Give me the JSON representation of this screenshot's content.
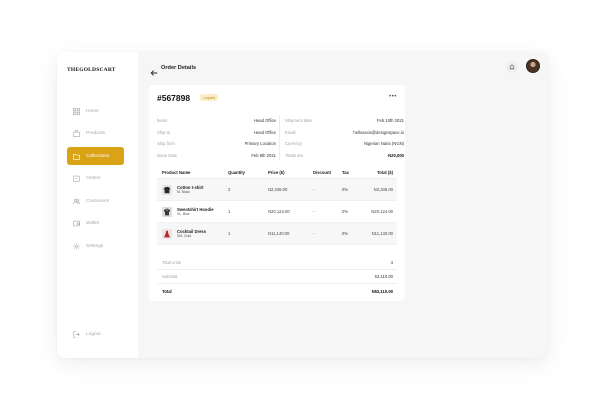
{
  "app": {
    "brand": "THEGOLDSCART",
    "page_title": "Order Details"
  },
  "sidebar": {
    "items": [
      {
        "label": "Home",
        "icon": "grid-icon"
      },
      {
        "label": "Products",
        "icon": "bag-icon"
      },
      {
        "label": "Collections",
        "icon": "folder-icon",
        "active": true
      },
      {
        "label": "Orders",
        "icon": "box-icon"
      },
      {
        "label": "Customers",
        "icon": "users-icon"
      },
      {
        "label": "Wallet",
        "icon": "wallet-icon"
      },
      {
        "label": "Settings",
        "icon": "gear-icon"
      }
    ],
    "logout_label": "Logout"
  },
  "order": {
    "number": "#567898",
    "status": "unpaid",
    "left_info": [
      {
        "label": "Items",
        "value": "Head Office"
      },
      {
        "label": "Ship to",
        "value": "Head Office"
      },
      {
        "label": "Ship from",
        "value": "Primary Location"
      },
      {
        "label": "Issue Date",
        "value": "Feb 8th 2021"
      }
    ],
    "right_info": [
      {
        "label": "Shipment date",
        "value": "Feb 10th 2021"
      },
      {
        "label": "Email",
        "value": "helloaxxix@designspace.io"
      },
      {
        "label": "Currency",
        "value": "Nigerian Naira (NGN)"
      },
      {
        "label": "Totals are",
        "value": "N20,000"
      }
    ]
  },
  "table": {
    "headers": [
      "Product Name",
      "Quantity",
      "Price ($)",
      "Discount",
      "Tax",
      "Total ($)"
    ],
    "rows": [
      {
        "name": "Cotton t-shirt",
        "variant": "M, Black",
        "qty": "2",
        "price": "N2,345.00",
        "discount": "-",
        "tax": "0%",
        "total": "N2,345.00"
      },
      {
        "name": "Sweatshirt Hoodie",
        "variant": "XL, Blue",
        "qty": "1",
        "price": "N20,124.00",
        "discount": "-",
        "tax": "0%",
        "total": "N20,124.00"
      },
      {
        "name": "Cocktail Dress",
        "variant": "SM, Gold",
        "qty": "1",
        "price": "N11,140.00",
        "discount": "-",
        "tax": "0%",
        "total": "N11,140.00"
      }
    ]
  },
  "summary": {
    "total_units_label": "Total units",
    "total_units": "4",
    "subtotal_label": "Subtotal",
    "subtotal": "53,110.00",
    "total_label": "Total",
    "total": "N53,110.00"
  },
  "colors": {
    "accent": "#daa316",
    "badge_bg": "#fbeccb",
    "badge_text": "#c98f0a"
  }
}
